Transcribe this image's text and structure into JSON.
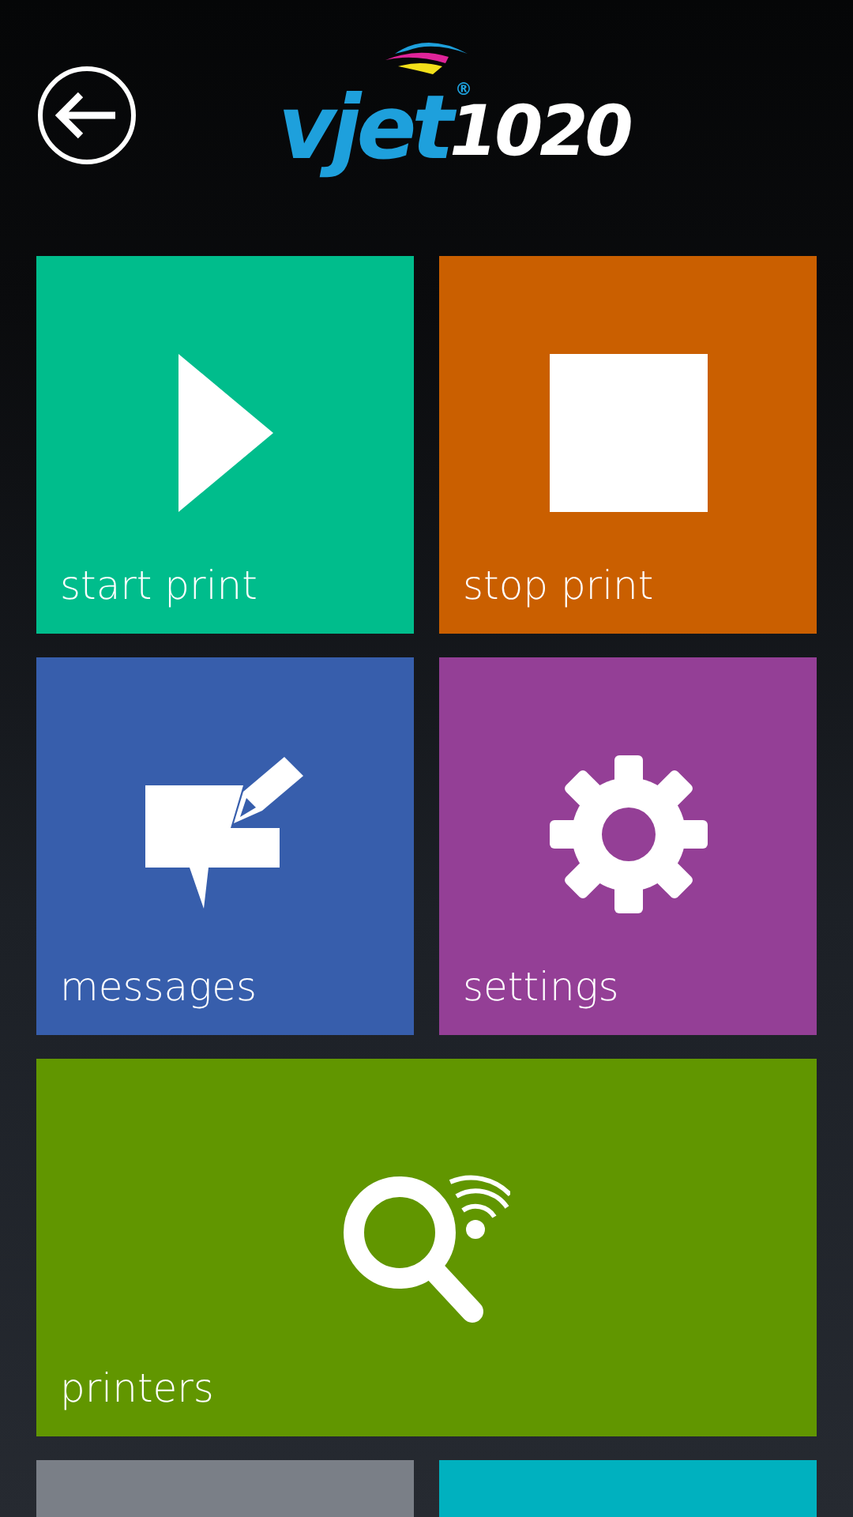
{
  "header": {
    "logo": {
      "brand": "vjet",
      "model": "1020",
      "mark": "®"
    }
  },
  "tiles": [
    {
      "label": "start print",
      "kind": "play",
      "color": "#00bd8c",
      "wide": false
    },
    {
      "label": "stop print",
      "kind": "stop",
      "color": "#ca5f00",
      "wide": false
    },
    {
      "label": "messages",
      "kind": "message",
      "color": "#375eac",
      "wide": false
    },
    {
      "label": "settings",
      "kind": "gear",
      "color": "#943f96",
      "wide": false
    },
    {
      "label": "printers",
      "kind": "search",
      "color": "#619600",
      "wide": true
    },
    {
      "kind": "blank",
      "color": "#7a7f87",
      "wide": false
    },
    {
      "kind": "blank",
      "color": "#00b1bf",
      "wide": false
    }
  ]
}
